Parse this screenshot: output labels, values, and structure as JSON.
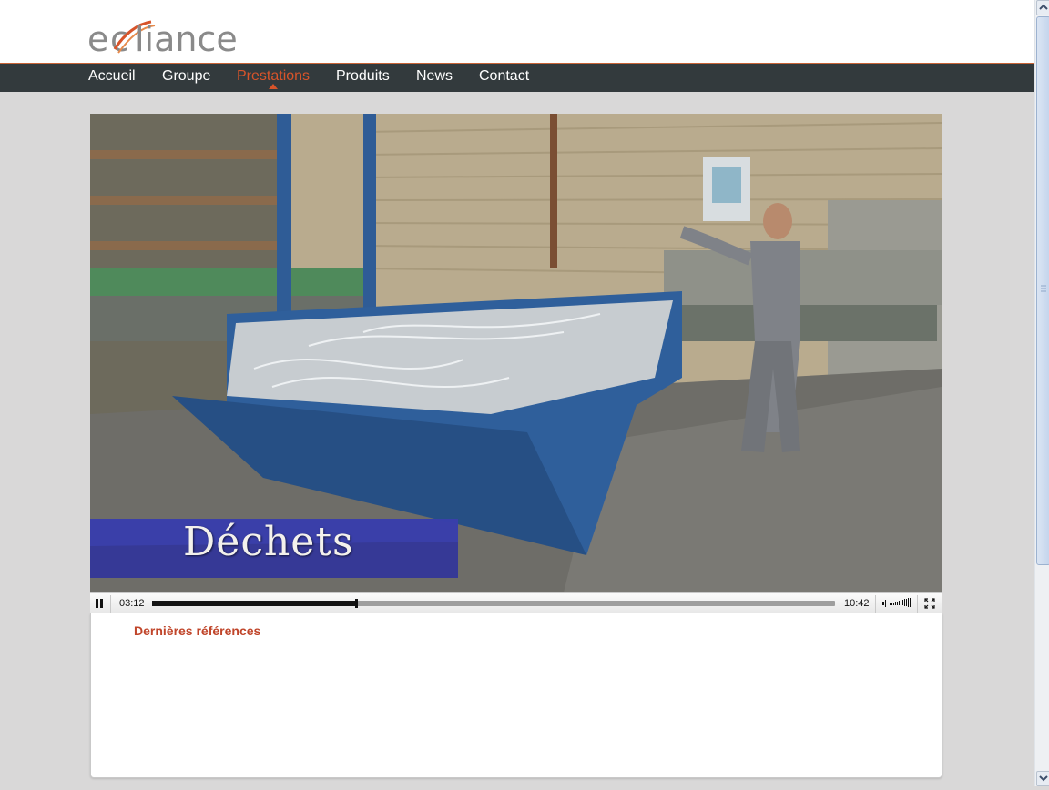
{
  "header": {
    "logo_text": "ecliance"
  },
  "nav": {
    "items": [
      {
        "label": "Accueil",
        "active": false
      },
      {
        "label": "Groupe",
        "active": false
      },
      {
        "label": "Prestations",
        "active": true
      },
      {
        "label": "Produits",
        "active": false
      },
      {
        "label": "News",
        "active": false
      },
      {
        "label": "Contact",
        "active": false
      }
    ]
  },
  "video": {
    "caption": "Déchets",
    "current_time": "03:12",
    "duration": "10:42",
    "progress": 0.299,
    "state": "playing",
    "icons": {
      "pause": "pause-icon",
      "volume": "volume-icon",
      "fullscreen": "fullscreen-icon"
    }
  },
  "panel": {
    "title": "Dernières références"
  },
  "colors": {
    "accent": "#d8542a",
    "nav_bg": "#333a3d",
    "page_bg": "#d9d8d8",
    "panel_title": "#c0452a"
  }
}
